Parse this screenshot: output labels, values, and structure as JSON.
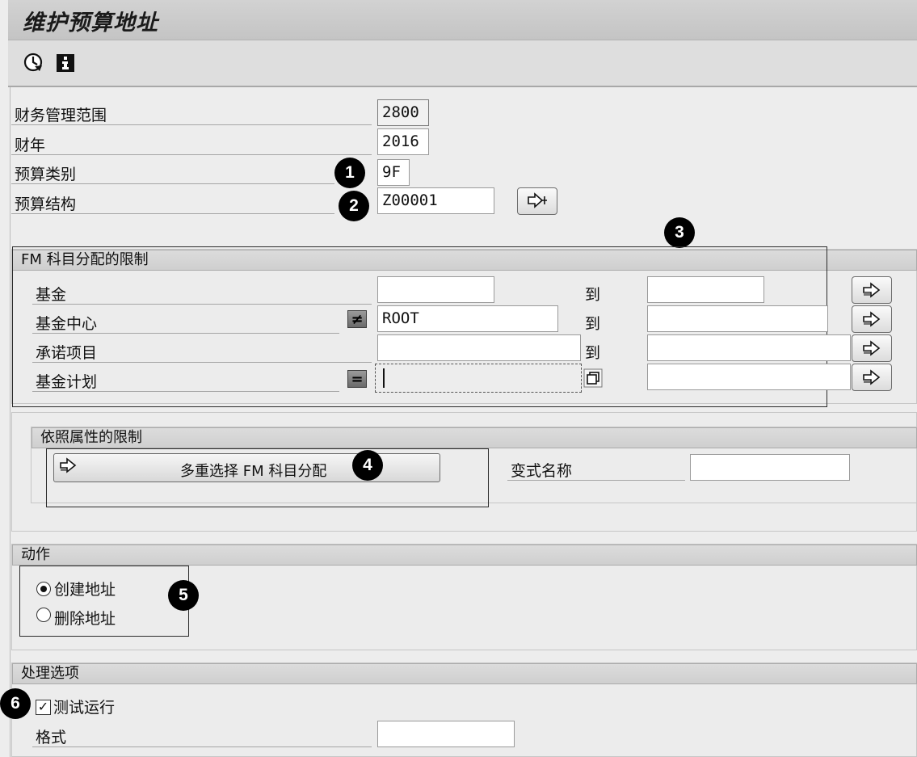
{
  "title": "维护预算地址",
  "toolbar": {
    "execute_icon": "clock-execute-icon",
    "info_icon": "info-icon"
  },
  "header_fields": {
    "fm_area": {
      "label": "财务管理范围",
      "value": "2800"
    },
    "fiscal_year": {
      "label": "财年",
      "value": "2016"
    },
    "budget_category": {
      "label": "预算类别",
      "value": "9F"
    },
    "budget_structure": {
      "label": "预算结构",
      "value": "Z00001"
    }
  },
  "fm_section": {
    "title": "FM 科目分配的限制",
    "to_label": "到",
    "rows": [
      {
        "label": "基金",
        "from": "",
        "to": ""
      },
      {
        "label": "基金中心",
        "from": "ROOT",
        "to": "",
        "operator": "≠"
      },
      {
        "label": "承诺项目",
        "from": "",
        "to": ""
      },
      {
        "label": "基金计划",
        "from": "",
        "to": "",
        "operator": "="
      }
    ]
  },
  "attr_section": {
    "title": "依照属性的限制",
    "multi_select_label": "多重选择 FM 科目分配",
    "variant_label": "变式名称",
    "variant_value": ""
  },
  "action_section": {
    "title": "动作",
    "options": [
      {
        "label": "创建地址",
        "selected": true
      },
      {
        "label": "删除地址",
        "selected": false
      }
    ]
  },
  "processing_section": {
    "title": "处理选项",
    "test_run_label": "测试运行",
    "test_run_checked": true,
    "format_label": "格式",
    "format_value": ""
  },
  "callouts": [
    "1",
    "2",
    "3",
    "4",
    "5",
    "6"
  ]
}
